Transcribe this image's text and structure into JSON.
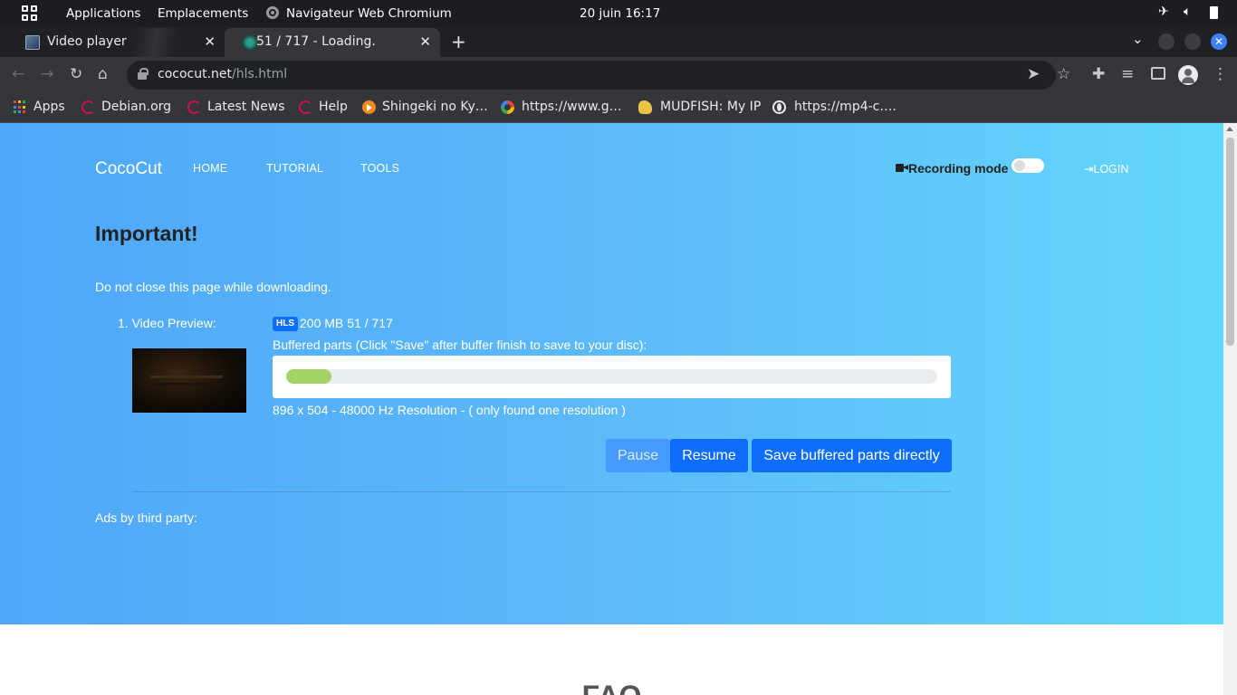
{
  "os_panel": {
    "applications": "Applications",
    "places": "Emplacements",
    "active_app": "Navigateur Web Chromium",
    "clock": "20 juin  16:17"
  },
  "tabs": [
    {
      "title": "Video player"
    },
    {
      "title": "51 / 717 - Loading."
    }
  ],
  "toolbar": {
    "url_host": "cococut.net",
    "url_path": "/hls.html"
  },
  "bookmarks": [
    {
      "label": "Apps",
      "icon": "apps-grid-icon"
    },
    {
      "label": "Debian.org",
      "icon": "debian-icon"
    },
    {
      "label": "Latest News",
      "icon": "debian-icon"
    },
    {
      "label": "Help",
      "icon": "debian-icon"
    },
    {
      "label": "Shingeki no Ky…",
      "icon": "play-icon"
    },
    {
      "label": "https://www.g…",
      "icon": "google-icon"
    },
    {
      "label": "MUDFISH: My IP",
      "icon": "mudfish-icon"
    },
    {
      "label": "https://mp4-c….",
      "icon": "globe-icon"
    }
  ],
  "site": {
    "brand": "CocoCut",
    "nav": {
      "home": "HOME",
      "tutorial": "TUTORIAL",
      "tools": "TOOLS"
    },
    "recording_mode": "Recording mode",
    "login": "LOGIN",
    "heading": "Important!",
    "warning": "Do not close this page while downloading.",
    "video": {
      "label": "1. Video Preview:",
      "badge": "HLS",
      "size": "200 MB",
      "parts": "51 / 717",
      "buffer_label": "Buffered parts (Click \"Save\" after buffer finish to save to your disc):",
      "buffer_progress": 0.07,
      "resolution": "896 x 504 - 48000 Hz Resolution - ( only found one resolution )"
    },
    "buttons": {
      "pause": "Pause",
      "resume": "Resume",
      "save": "Save buffered parts directly"
    },
    "ads": "Ads by third party:",
    "faq": "FAQ"
  },
  "colors": {
    "accent": "#0d6efd",
    "progress": "#a2d364",
    "hero_start": "#4ea7fb",
    "hero_end": "#62d7fd"
  }
}
